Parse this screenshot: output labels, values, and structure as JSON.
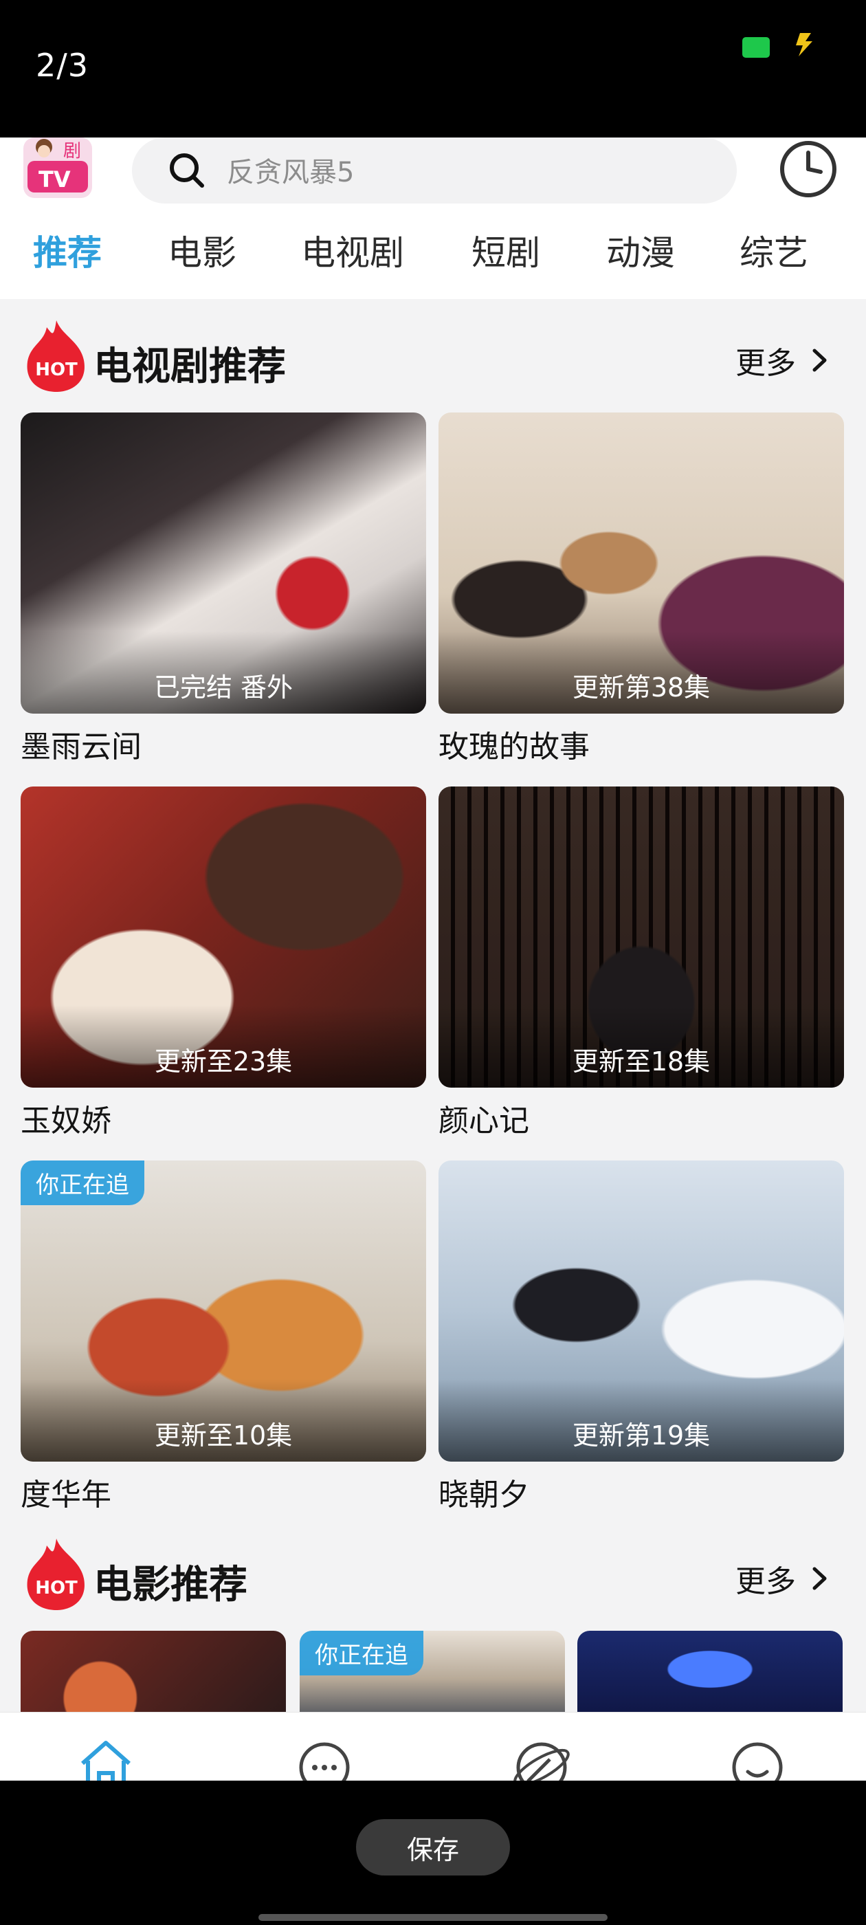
{
  "viewer": {
    "page_counter": "2/3",
    "save_label": "保存"
  },
  "app": {
    "logo_text": "剧 TV",
    "search": {
      "placeholder": "反贪风暴5"
    },
    "tabs": [
      "推荐",
      "电影",
      "电视剧",
      "短剧",
      "动漫",
      "综艺"
    ],
    "active_tab": "推荐"
  },
  "sections": [
    {
      "title": "电视剧推荐",
      "more": "更多",
      "items": [
        {
          "title": "墨雨云间",
          "status": "已完结 番外",
          "chasing": ""
        },
        {
          "title": "玫瑰的故事",
          "status": "更新第38集",
          "chasing": ""
        },
        {
          "title": "玉奴娇",
          "status": "更新至23集",
          "chasing": ""
        },
        {
          "title": "颜心记",
          "status": "更新至18集",
          "chasing": ""
        },
        {
          "title": "度华年",
          "status": "更新至10集",
          "chasing": "你正在追"
        },
        {
          "title": "晓朝夕",
          "status": "更新第19集",
          "chasing": ""
        }
      ]
    },
    {
      "title": "电影推荐",
      "more": "更多",
      "items": [
        {
          "chasing": ""
        },
        {
          "chasing": "你正在追"
        },
        {
          "chasing": ""
        }
      ]
    }
  ],
  "bottom_nav": [
    {
      "icon": "home-icon",
      "active": true
    },
    {
      "icon": "chat-icon",
      "active": false
    },
    {
      "icon": "discover-icon",
      "active": false
    },
    {
      "icon": "profile-icon",
      "active": false
    }
  ],
  "colors": {
    "accent": "#2fa0dd",
    "hot": "#e8212f",
    "badge": "#2fa0dd"
  }
}
